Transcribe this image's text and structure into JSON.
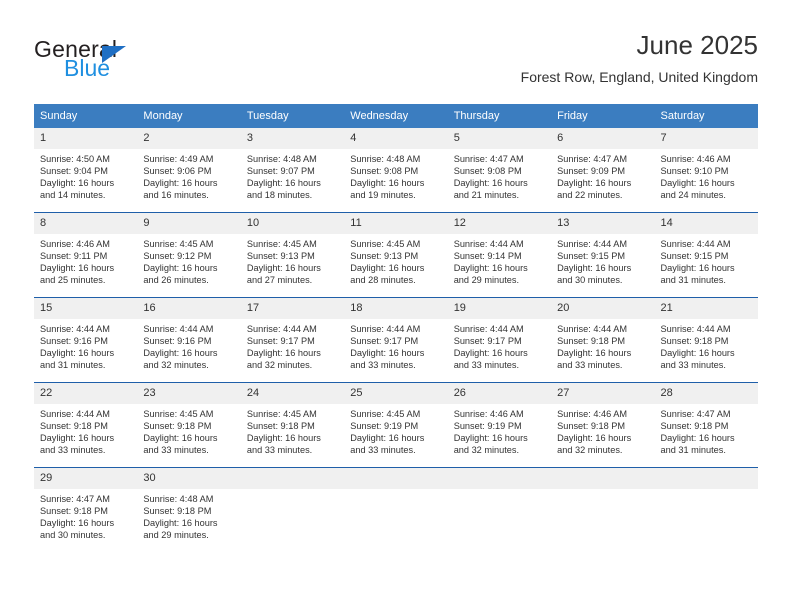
{
  "brand": {
    "name_dark": "General",
    "name_blue": "Blue",
    "accent_blue": "#1f8fe0",
    "triangle_blue": "#1f6fc4"
  },
  "header": {
    "title": "June 2025",
    "subtitle": "Forest Row, England, United Kingdom"
  },
  "theme": {
    "header_row_bg": "#3b7dc0",
    "row_separator": "#1f5fa9",
    "daynum_bg": "#f0f0f0",
    "text": "#333333"
  },
  "columns": [
    "Sunday",
    "Monday",
    "Tuesday",
    "Wednesday",
    "Thursday",
    "Friday",
    "Saturday"
  ],
  "weeks": [
    [
      {
        "day": "1",
        "sunrise": "Sunrise: 4:50 AM",
        "sunset": "Sunset: 9:04 PM",
        "daylight_line1": "Daylight: 16 hours",
        "daylight_line2": "and 14 minutes."
      },
      {
        "day": "2",
        "sunrise": "Sunrise: 4:49 AM",
        "sunset": "Sunset: 9:06 PM",
        "daylight_line1": "Daylight: 16 hours",
        "daylight_line2": "and 16 minutes."
      },
      {
        "day": "3",
        "sunrise": "Sunrise: 4:48 AM",
        "sunset": "Sunset: 9:07 PM",
        "daylight_line1": "Daylight: 16 hours",
        "daylight_line2": "and 18 minutes."
      },
      {
        "day": "4",
        "sunrise": "Sunrise: 4:48 AM",
        "sunset": "Sunset: 9:08 PM",
        "daylight_line1": "Daylight: 16 hours",
        "daylight_line2": "and 19 minutes."
      },
      {
        "day": "5",
        "sunrise": "Sunrise: 4:47 AM",
        "sunset": "Sunset: 9:08 PM",
        "daylight_line1": "Daylight: 16 hours",
        "daylight_line2": "and 21 minutes."
      },
      {
        "day": "6",
        "sunrise": "Sunrise: 4:47 AM",
        "sunset": "Sunset: 9:09 PM",
        "daylight_line1": "Daylight: 16 hours",
        "daylight_line2": "and 22 minutes."
      },
      {
        "day": "7",
        "sunrise": "Sunrise: 4:46 AM",
        "sunset": "Sunset: 9:10 PM",
        "daylight_line1": "Daylight: 16 hours",
        "daylight_line2": "and 24 minutes."
      }
    ],
    [
      {
        "day": "8",
        "sunrise": "Sunrise: 4:46 AM",
        "sunset": "Sunset: 9:11 PM",
        "daylight_line1": "Daylight: 16 hours",
        "daylight_line2": "and 25 minutes."
      },
      {
        "day": "9",
        "sunrise": "Sunrise: 4:45 AM",
        "sunset": "Sunset: 9:12 PM",
        "daylight_line1": "Daylight: 16 hours",
        "daylight_line2": "and 26 minutes."
      },
      {
        "day": "10",
        "sunrise": "Sunrise: 4:45 AM",
        "sunset": "Sunset: 9:13 PM",
        "daylight_line1": "Daylight: 16 hours",
        "daylight_line2": "and 27 minutes."
      },
      {
        "day": "11",
        "sunrise": "Sunrise: 4:45 AM",
        "sunset": "Sunset: 9:13 PM",
        "daylight_line1": "Daylight: 16 hours",
        "daylight_line2": "and 28 minutes."
      },
      {
        "day": "12",
        "sunrise": "Sunrise: 4:44 AM",
        "sunset": "Sunset: 9:14 PM",
        "daylight_line1": "Daylight: 16 hours",
        "daylight_line2": "and 29 minutes."
      },
      {
        "day": "13",
        "sunrise": "Sunrise: 4:44 AM",
        "sunset": "Sunset: 9:15 PM",
        "daylight_line1": "Daylight: 16 hours",
        "daylight_line2": "and 30 minutes."
      },
      {
        "day": "14",
        "sunrise": "Sunrise: 4:44 AM",
        "sunset": "Sunset: 9:15 PM",
        "daylight_line1": "Daylight: 16 hours",
        "daylight_line2": "and 31 minutes."
      }
    ],
    [
      {
        "day": "15",
        "sunrise": "Sunrise: 4:44 AM",
        "sunset": "Sunset: 9:16 PM",
        "daylight_line1": "Daylight: 16 hours",
        "daylight_line2": "and 31 minutes."
      },
      {
        "day": "16",
        "sunrise": "Sunrise: 4:44 AM",
        "sunset": "Sunset: 9:16 PM",
        "daylight_line1": "Daylight: 16 hours",
        "daylight_line2": "and 32 minutes."
      },
      {
        "day": "17",
        "sunrise": "Sunrise: 4:44 AM",
        "sunset": "Sunset: 9:17 PM",
        "daylight_line1": "Daylight: 16 hours",
        "daylight_line2": "and 32 minutes."
      },
      {
        "day": "18",
        "sunrise": "Sunrise: 4:44 AM",
        "sunset": "Sunset: 9:17 PM",
        "daylight_line1": "Daylight: 16 hours",
        "daylight_line2": "and 33 minutes."
      },
      {
        "day": "19",
        "sunrise": "Sunrise: 4:44 AM",
        "sunset": "Sunset: 9:17 PM",
        "daylight_line1": "Daylight: 16 hours",
        "daylight_line2": "and 33 minutes."
      },
      {
        "day": "20",
        "sunrise": "Sunrise: 4:44 AM",
        "sunset": "Sunset: 9:18 PM",
        "daylight_line1": "Daylight: 16 hours",
        "daylight_line2": "and 33 minutes."
      },
      {
        "day": "21",
        "sunrise": "Sunrise: 4:44 AM",
        "sunset": "Sunset: 9:18 PM",
        "daylight_line1": "Daylight: 16 hours",
        "daylight_line2": "and 33 minutes."
      }
    ],
    [
      {
        "day": "22",
        "sunrise": "Sunrise: 4:44 AM",
        "sunset": "Sunset: 9:18 PM",
        "daylight_line1": "Daylight: 16 hours",
        "daylight_line2": "and 33 minutes."
      },
      {
        "day": "23",
        "sunrise": "Sunrise: 4:45 AM",
        "sunset": "Sunset: 9:18 PM",
        "daylight_line1": "Daylight: 16 hours",
        "daylight_line2": "and 33 minutes."
      },
      {
        "day": "24",
        "sunrise": "Sunrise: 4:45 AM",
        "sunset": "Sunset: 9:18 PM",
        "daylight_line1": "Daylight: 16 hours",
        "daylight_line2": "and 33 minutes."
      },
      {
        "day": "25",
        "sunrise": "Sunrise: 4:45 AM",
        "sunset": "Sunset: 9:19 PM",
        "daylight_line1": "Daylight: 16 hours",
        "daylight_line2": "and 33 minutes."
      },
      {
        "day": "26",
        "sunrise": "Sunrise: 4:46 AM",
        "sunset": "Sunset: 9:19 PM",
        "daylight_line1": "Daylight: 16 hours",
        "daylight_line2": "and 32 minutes."
      },
      {
        "day": "27",
        "sunrise": "Sunrise: 4:46 AM",
        "sunset": "Sunset: 9:18 PM",
        "daylight_line1": "Daylight: 16 hours",
        "daylight_line2": "and 32 minutes."
      },
      {
        "day": "28",
        "sunrise": "Sunrise: 4:47 AM",
        "sunset": "Sunset: 9:18 PM",
        "daylight_line1": "Daylight: 16 hours",
        "daylight_line2": "and 31 minutes."
      }
    ],
    [
      {
        "day": "29",
        "sunrise": "Sunrise: 4:47 AM",
        "sunset": "Sunset: 9:18 PM",
        "daylight_line1": "Daylight: 16 hours",
        "daylight_line2": "and 30 minutes."
      },
      {
        "day": "30",
        "sunrise": "Sunrise: 4:48 AM",
        "sunset": "Sunset: 9:18 PM",
        "daylight_line1": "Daylight: 16 hours",
        "daylight_line2": "and 29 minutes."
      },
      {
        "day": "",
        "sunrise": "",
        "sunset": "",
        "daylight_line1": "",
        "daylight_line2": ""
      },
      {
        "day": "",
        "sunrise": "",
        "sunset": "",
        "daylight_line1": "",
        "daylight_line2": ""
      },
      {
        "day": "",
        "sunrise": "",
        "sunset": "",
        "daylight_line1": "",
        "daylight_line2": ""
      },
      {
        "day": "",
        "sunrise": "",
        "sunset": "",
        "daylight_line1": "",
        "daylight_line2": ""
      },
      {
        "day": "",
        "sunrise": "",
        "sunset": "",
        "daylight_line1": "",
        "daylight_line2": ""
      }
    ]
  ]
}
